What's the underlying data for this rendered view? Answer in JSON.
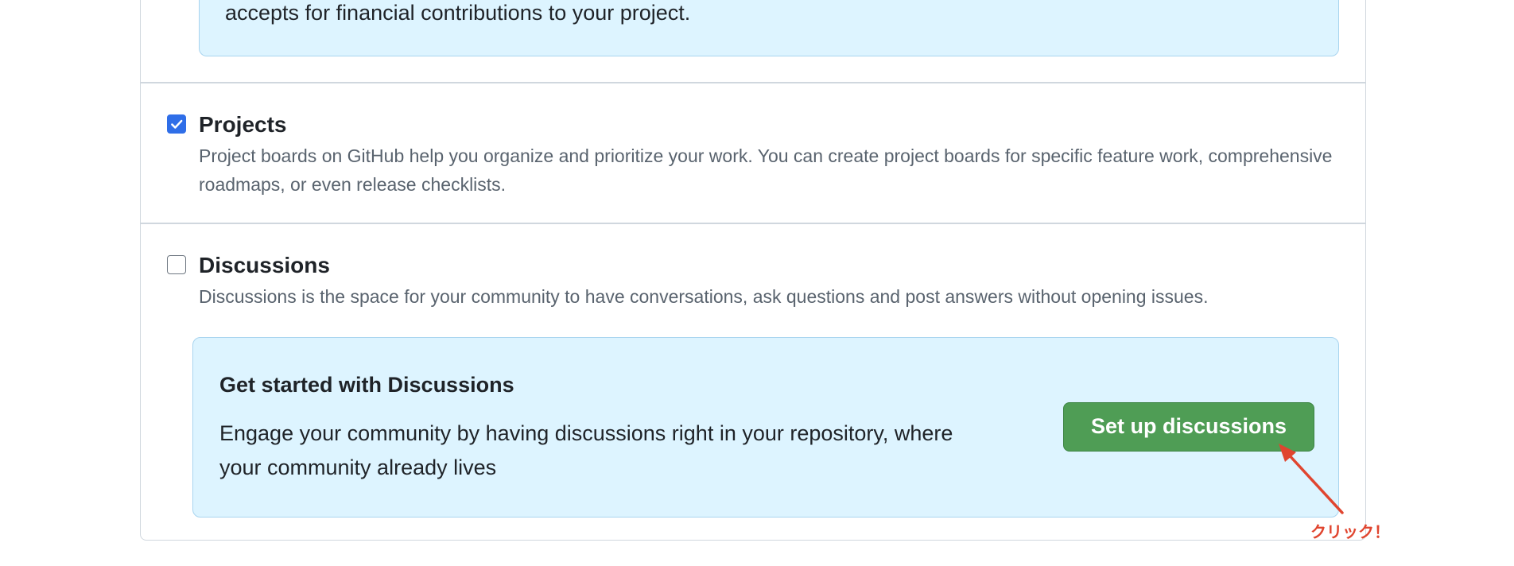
{
  "sponsorships": {
    "callout_text": "accepts for financial contributions to your project."
  },
  "features": [
    {
      "title": "Projects",
      "checked": true,
      "description": "Project boards on GitHub help you organize and prioritize your work. You can create project boards for specific feature work, comprehensive roadmaps, or even release checklists."
    },
    {
      "title": "Discussions",
      "checked": false,
      "description": "Discussions is the space for your community to have conversations, ask questions and post answers without opening issues."
    }
  ],
  "discussions_callout": {
    "heading": "Get started with Discussions",
    "body": "Engage your community by having discussions right in your repository, where your community already lives",
    "button_label": "Set up discussions"
  },
  "annotation": {
    "text": "クリック！",
    "color": "#e0452f"
  },
  "colors": {
    "callout_background": "#ddf4ff",
    "button_green": "#4f9d55",
    "checkbox_blue": "#2f6ee8"
  },
  "icons": {
    "checked_checkbox": "checkmark-icon",
    "annotation_arrow": "arrow-icon"
  }
}
